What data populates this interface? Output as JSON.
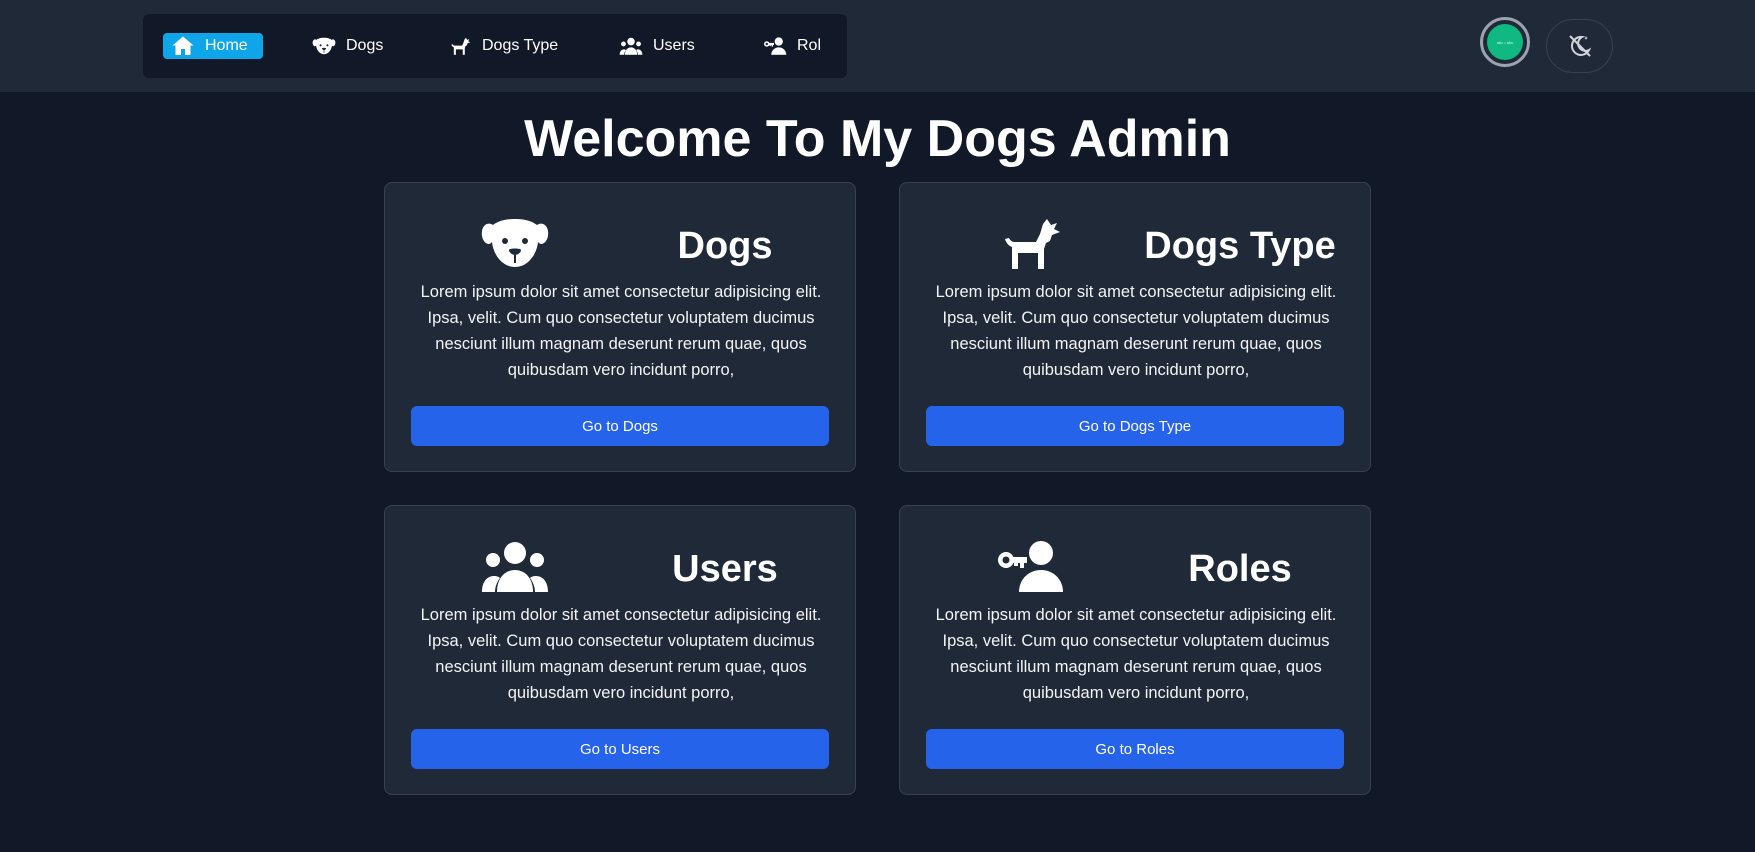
{
  "nav": {
    "items": [
      {
        "label": "Home",
        "icon": "home-icon",
        "active": true
      },
      {
        "label": "Dogs",
        "icon": "dog-face-icon"
      },
      {
        "label": "Dogs Type",
        "icon": "dog-icon"
      },
      {
        "label": "Users",
        "icon": "users-icon"
      },
      {
        "label": "Rol",
        "icon": "user-key-icon"
      }
    ]
  },
  "header": {
    "avatar_text": "abc • abc",
    "theme_toggle_icon": "moon-stars-slash-icon"
  },
  "page": {
    "title": "Welcome To My Dogs Admin"
  },
  "cards": [
    {
      "title": "Dogs",
      "icon": "dog-face-icon",
      "text": "Lorem ipsum dolor sit amet consectetur adipisicing elit. Ipsa, velit. Cum quo consectetur voluptatem ducimus nesciunt illum magnam deserunt rerum quae, quos quibusdam vero incidunt porro,",
      "button": "Go to Dogs"
    },
    {
      "title": "Dogs Type",
      "icon": "dog-icon",
      "text": "Lorem ipsum dolor sit amet consectetur adipisicing elit. Ipsa, velit. Cum quo consectetur voluptatem ducimus nesciunt illum magnam deserunt rerum quae, quos quibusdam vero incidunt porro,",
      "button": "Go to Dogs Type"
    },
    {
      "title": "Users",
      "icon": "users-icon",
      "text": "Lorem ipsum dolor sit amet consectetur adipisicing elit. Ipsa, velit. Cum quo consectetur voluptatem ducimus nesciunt illum magnam deserunt rerum quae, quos quibusdam vero incidunt porro,",
      "button": "Go to Users"
    },
    {
      "title": "Roles",
      "icon": "user-key-icon",
      "text": "Lorem ipsum dolor sit amet consectetur adipisicing elit. Ipsa, velit. Cum quo consectetur voluptatem ducimus nesciunt illum magnam deserunt rerum quae, quos quibusdam vero incidunt porro,",
      "button": "Go to Roles"
    }
  ],
  "colors": {
    "background": "#111827",
    "surface": "#1f2937",
    "nav_active": "#0ea5e9",
    "primary_button": "#2563eb",
    "avatar": "#10b981"
  }
}
